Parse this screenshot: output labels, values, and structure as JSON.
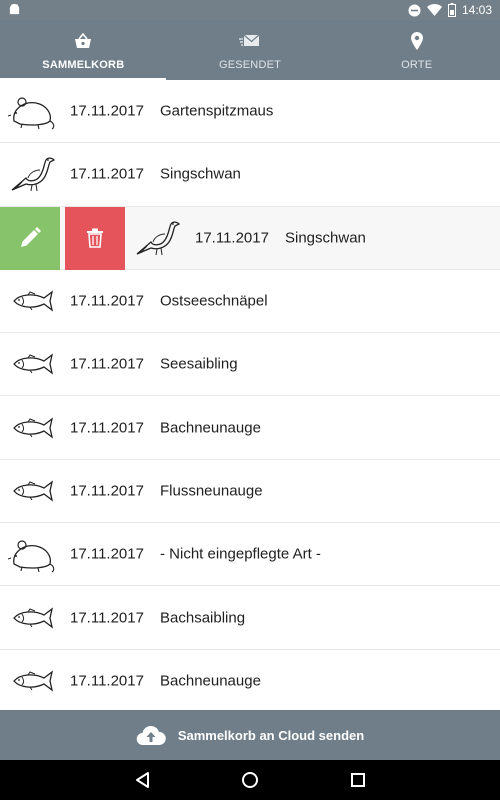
{
  "status_bar": {
    "time": "14:03"
  },
  "tabs": [
    {
      "label": "SAMMELKORB",
      "icon": "basket-icon",
      "active": true
    },
    {
      "label": "GESENDET",
      "icon": "sent-mail-icon",
      "active": false
    },
    {
      "label": "ORTE",
      "icon": "location-pin-icon",
      "active": false
    }
  ],
  "list": {
    "rows": [
      {
        "date": "17.11.2017",
        "name": "Gartenspitzmaus",
        "animal": "mammal-icon"
      },
      {
        "date": "17.11.2017",
        "name": "Singschwan",
        "animal": "bird-icon"
      },
      {
        "date": "17.11.2017",
        "name": "Singschwan",
        "animal": "bird-icon",
        "swiped": true
      },
      {
        "date": "17.11.2017",
        "name": "Ostseeschnäpel",
        "animal": "fish-icon"
      },
      {
        "date": "17.11.2017",
        "name": "Seesaibling",
        "animal": "fish-icon"
      },
      {
        "date": "17.11.2017",
        "name": "Bachneunauge",
        "animal": "fish-icon"
      },
      {
        "date": "17.11.2017",
        "name": "Flussneunauge",
        "animal": "fish-icon"
      },
      {
        "date": "17.11.2017",
        "name": "- Nicht eingepflegte Art -",
        "animal": "mammal-icon"
      },
      {
        "date": "17.11.2017",
        "name": "Bachsaibling",
        "animal": "fish-icon"
      },
      {
        "date": "17.11.2017",
        "name": "Bachneunauge",
        "animal": "fish-icon"
      }
    ]
  },
  "action_bar": {
    "label": "Sammelkorb an Cloud senden",
    "icon": "cloud-upload-icon"
  },
  "nav": {
    "back": "back-icon",
    "home": "home-icon",
    "recents": "recents-icon"
  },
  "colors": {
    "toolbar": "#707e89",
    "edit": "#86c36a",
    "delete": "#e4545a"
  }
}
